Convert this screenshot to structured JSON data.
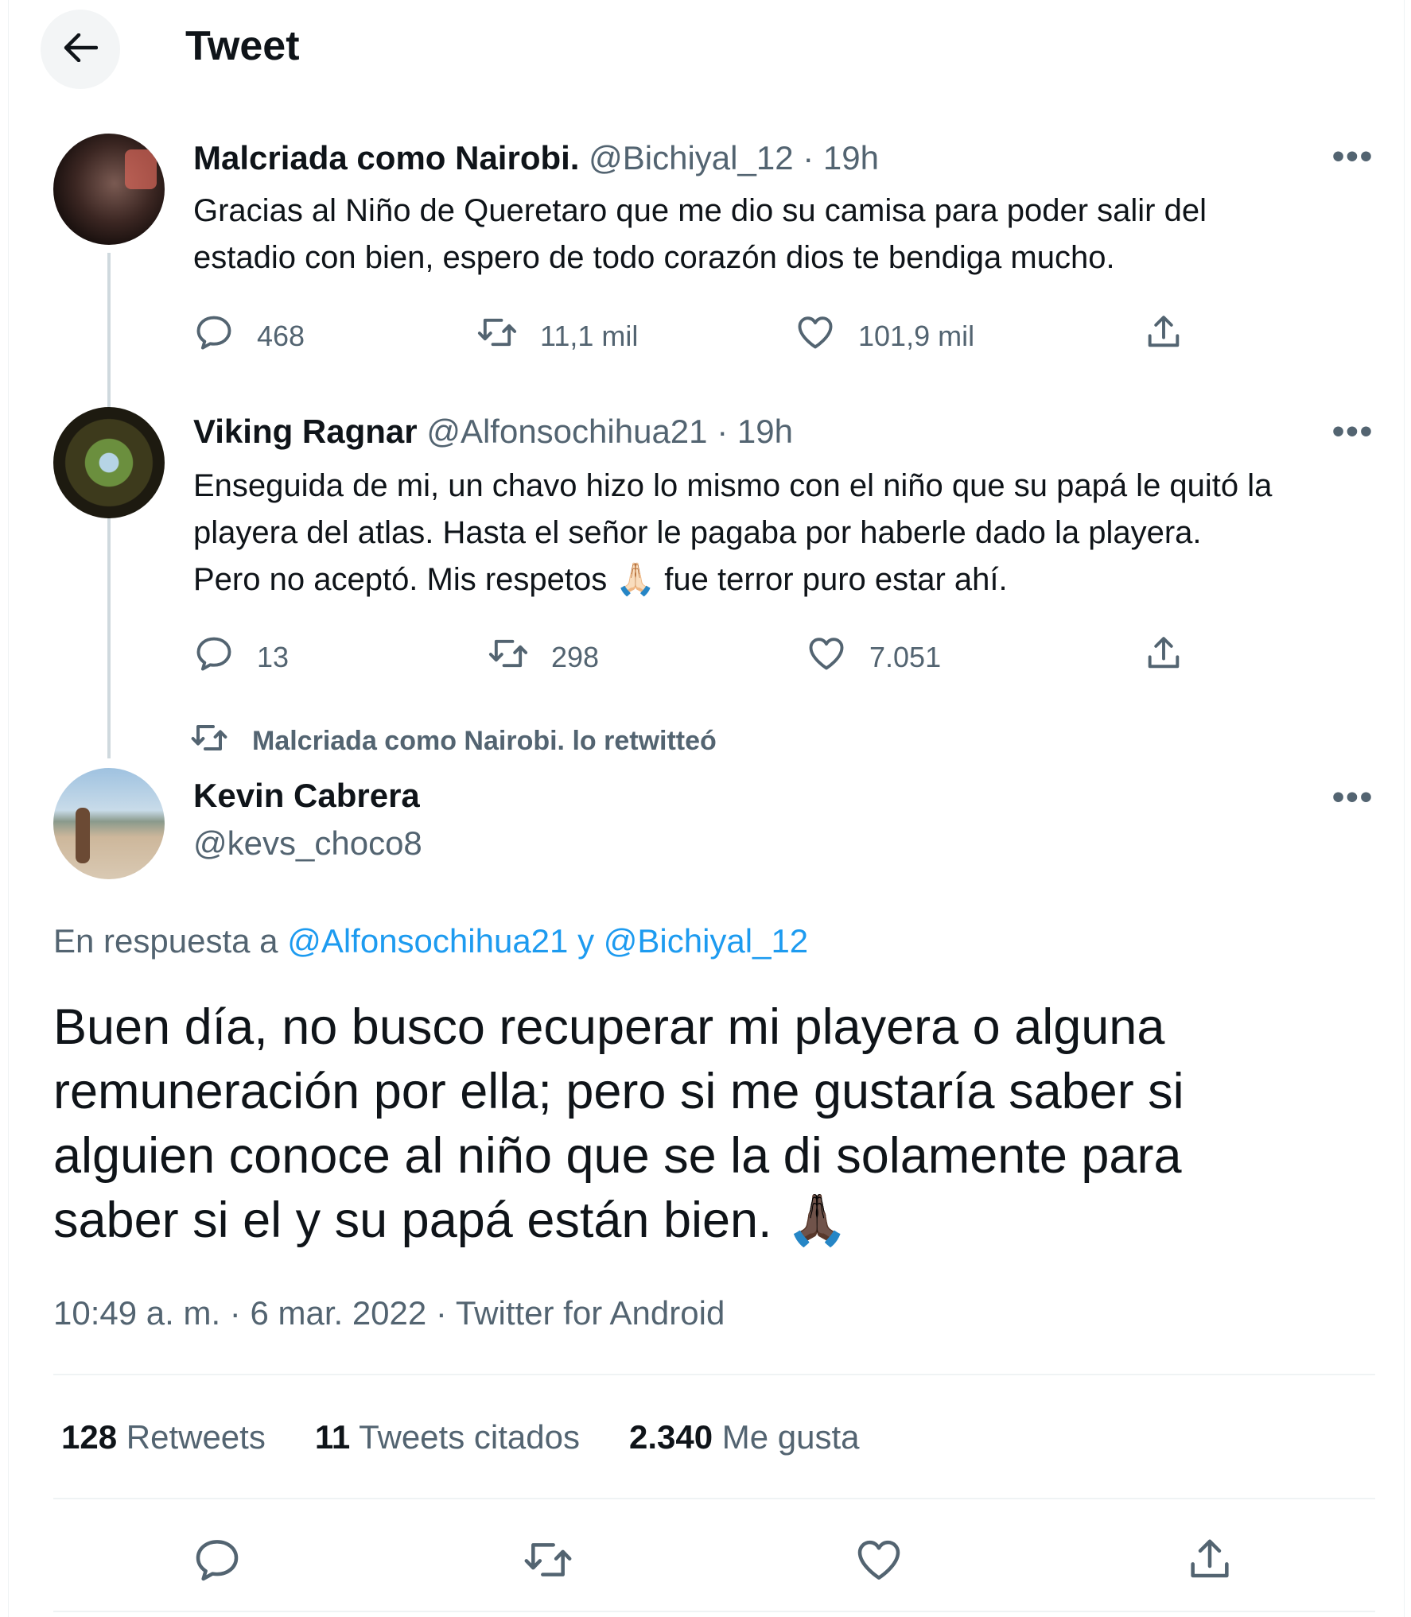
{
  "header": {
    "title": "Tweet"
  },
  "tweets": [
    {
      "name": "Malcriada como Nairobi.",
      "handle": "@Bichiyal_12",
      "separator": "·",
      "time": "19h",
      "lines": [
        "Gracias al Niño de Queretaro que me dio su camisa para poder salir del",
        "estadio con bien, espero de todo corazón dios te bendiga mucho."
      ],
      "replies": "468",
      "retweets": "11,1 mil",
      "likes": "101,9 mil"
    },
    {
      "name": "Viking Ragnar",
      "handle": "@Alfonsochihua21",
      "separator": "·",
      "time": "19h",
      "lines": [
        "Enseguida de mi, un chavo hizo lo mismo con el niño que su papá le quitó la",
        "playera del atlas. Hasta el señor le pagaba por haberle dado la playera.",
        "Pero no aceptó. Mis respetos 🙏🏻 fue terror puro estar ahí."
      ],
      "replies": "13",
      "retweets": "298",
      "likes": "7.051"
    }
  ],
  "retweet_note": "Malcriada como Nairobi. lo retwitteó",
  "main_tweet": {
    "name": "Kevin Cabrera",
    "handle": "@kevs_choco8",
    "reply_prefix": "En respuesta a",
    "reply_to": "@Alfonsochihua21 y @Bichiyal_12",
    "lines": [
      "Buen día, no busco recuperar mi playera o alguna",
      "remuneración por ella; pero si me gustaría saber si",
      "alguien conoce al niño que se la di solamente para",
      "saber si el y su papá están bien. 🙏🏿"
    ],
    "meta": "10:49 a. m. · 6 mar. 2022 · Twitter for Android",
    "stats": {
      "retweets_num": "128",
      "retweets_label": "Retweets",
      "quotes_num": "11",
      "quotes_label": "Tweets citados",
      "likes_num": "2.340",
      "likes_label": "Me gusta"
    }
  },
  "icons": {
    "back": "arrow-left-icon",
    "more": "more-dots-icon",
    "reply": "speech-bubble-icon",
    "retweet": "retweet-icon",
    "like": "heart-icon",
    "share": "share-upload-icon"
  },
  "colors": {
    "link": "#1d9bf0",
    "muted": "#536471",
    "text": "#0f1419"
  }
}
